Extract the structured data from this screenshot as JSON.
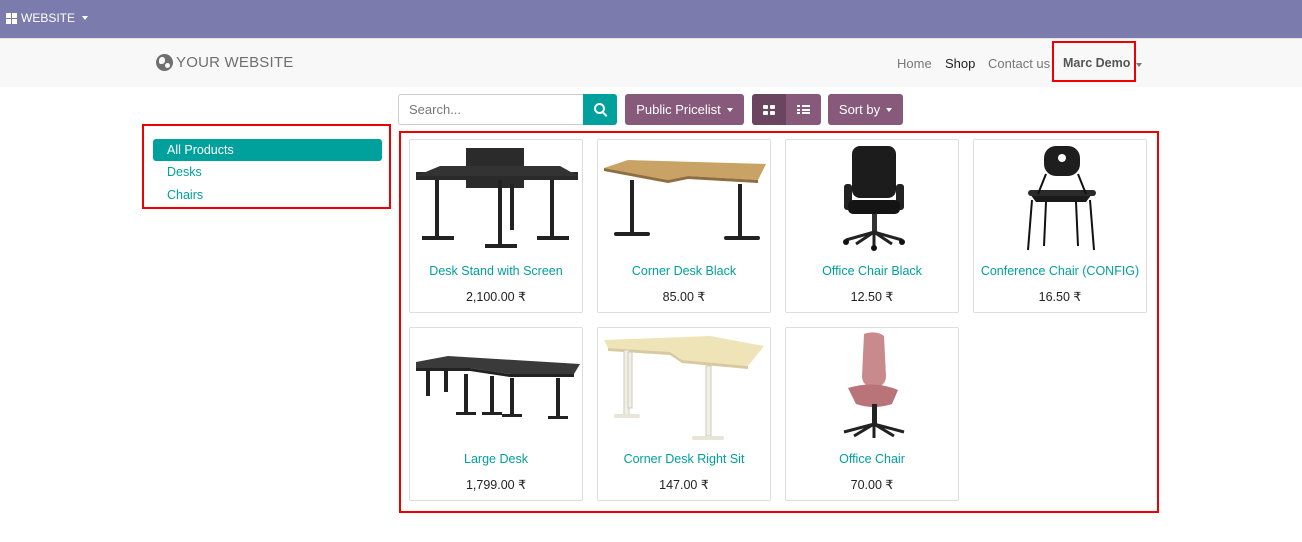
{
  "topbar": {
    "menu_label": "WEBSITE"
  },
  "header": {
    "brand": "YOUR WEBSITE",
    "nav": [
      "Home",
      "Shop",
      "Contact us"
    ],
    "user": "Marc Demo"
  },
  "toolbar": {
    "search_placeholder": "Search...",
    "pricelist_label": "Public Pricelist",
    "sort_label": "Sort by"
  },
  "categories": [
    "All Products",
    "Desks",
    "Chairs"
  ],
  "products": [
    {
      "name": "Desk Stand with Screen",
      "price": "2,100.00 ₹",
      "image": "desk-with-screen"
    },
    {
      "name": "Corner Desk Black",
      "price": "85.00 ₹",
      "image": "corner-desk-oak"
    },
    {
      "name": "Office Chair Black",
      "price": "12.50 ₹",
      "image": "office-chair-black"
    },
    {
      "name": "Conference Chair (CONFIG)",
      "price": "16.50 ₹",
      "image": "conference-chair"
    },
    {
      "name": "Large Desk",
      "price": "1,799.00 ₹",
      "image": "large-desk"
    },
    {
      "name": "Corner Desk Right Sit",
      "price": "147.00 ₹",
      "image": "corner-desk-white"
    },
    {
      "name": "Office Chair",
      "price": "70.00 ₹",
      "image": "office-chair-pink"
    }
  ],
  "colors": {
    "topbar": "#7c7bad",
    "primary": "#875a7b",
    "accent": "#00a09d"
  }
}
